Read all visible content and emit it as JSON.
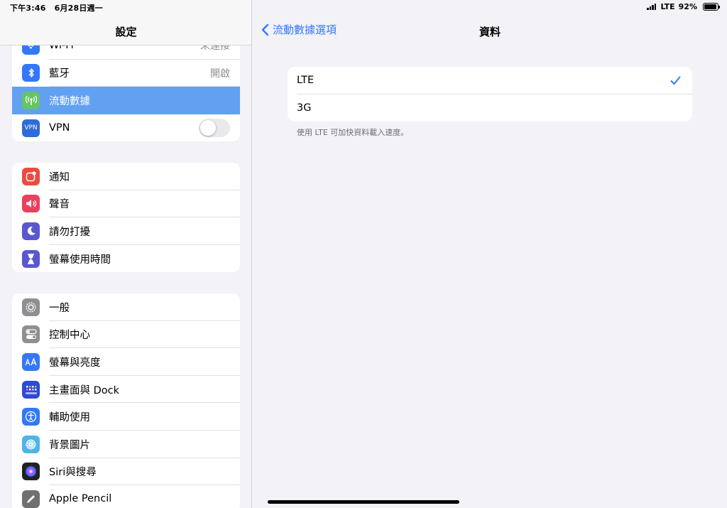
{
  "status": {
    "time": "下午3:46",
    "date": "6月28日週一",
    "network": "LTE",
    "battery": "92%"
  },
  "sidebar": {
    "title": "設定",
    "group1": [
      {
        "label": "Wi-Fi",
        "value": "未連接",
        "icon": "wifi-icon",
        "color": "#3478f6"
      },
      {
        "label": "藍牙",
        "value": "開啟",
        "icon": "bluetooth-icon",
        "color": "#3478f6"
      },
      {
        "label": "流動數據",
        "value": "",
        "icon": "antenna-icon",
        "color": "#65c466",
        "selected": true
      },
      {
        "label": "VPN",
        "value": "",
        "icon": "vpn-icon",
        "color": "#2f6bd9",
        "toggle": false
      }
    ],
    "group2": [
      {
        "label": "通知",
        "icon": "notification-icon",
        "color": "#ec4b3f"
      },
      {
        "label": "聲音",
        "icon": "speaker-icon",
        "color": "#eb3f5b"
      },
      {
        "label": "請勿打擾",
        "icon": "moon-icon",
        "color": "#5b57cf"
      },
      {
        "label": "螢幕使用時間",
        "icon": "hourglass-icon",
        "color": "#5b57cf"
      }
    ],
    "group3": [
      {
        "label": "一般",
        "icon": "gear-icon",
        "color": "#8e8e93"
      },
      {
        "label": "控制中心",
        "icon": "switches-icon",
        "color": "#8e8e93"
      },
      {
        "label": "螢幕與亮度",
        "icon": "text-size-icon",
        "color": "#3478f6"
      },
      {
        "label": "主畫面與 Dock",
        "icon": "home-grid-icon",
        "color": "#2c4ad6"
      },
      {
        "label": "輔助使用",
        "icon": "accessibility-icon",
        "color": "#3478f6"
      },
      {
        "label": "背景圖片",
        "icon": "flower-icon",
        "color": "#4fb4e8"
      },
      {
        "label": "Siri與搜尋",
        "icon": "siri-icon",
        "color": "#222222"
      },
      {
        "label": "Apple Pencil",
        "icon": "pencil-icon",
        "color": "#707070"
      }
    ]
  },
  "detail": {
    "back_label": "流動數據選項",
    "title": "資料",
    "options": [
      {
        "label": "LTE",
        "checked": true
      },
      {
        "label": "3G",
        "checked": false
      }
    ],
    "footnote": "使用 LTE 可加快資料載入速度。"
  },
  "colors": {
    "accent": "#3478f6",
    "selection": "#62a0f1"
  }
}
